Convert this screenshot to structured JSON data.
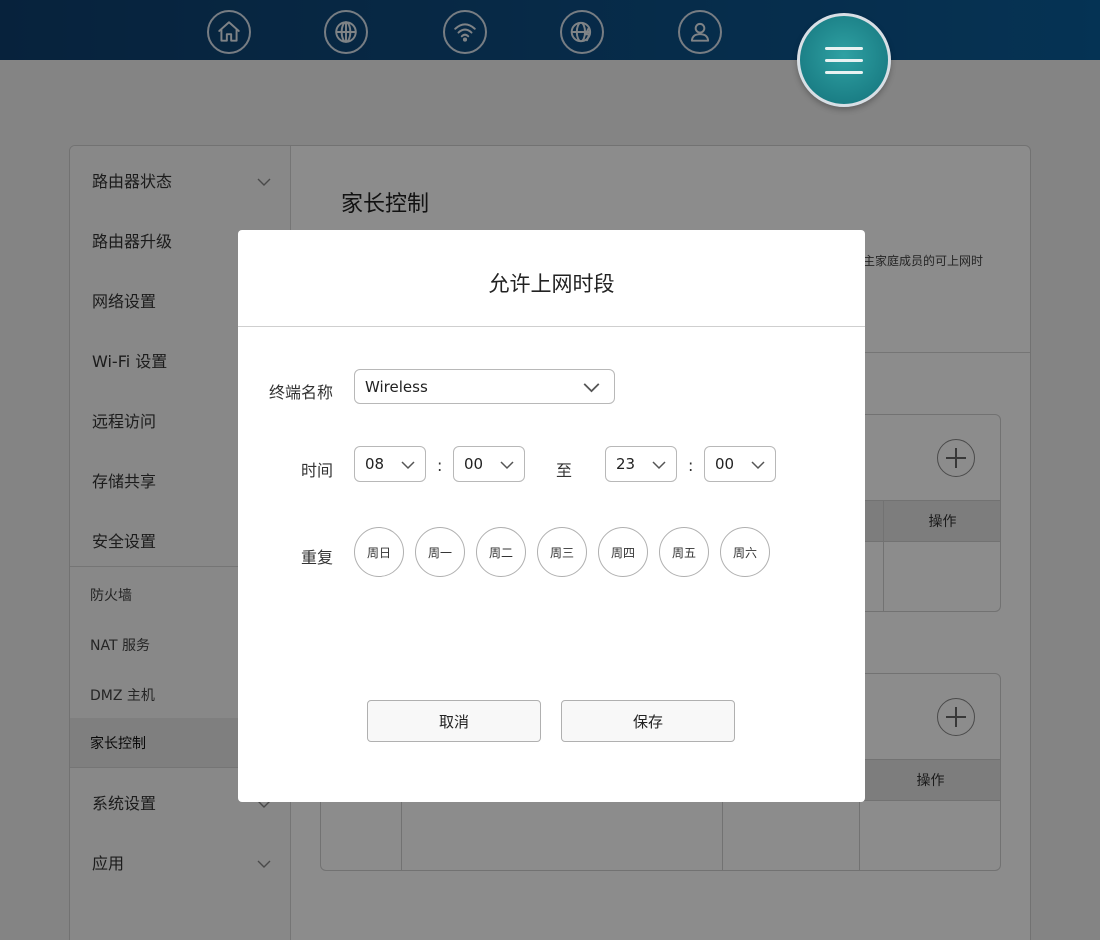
{
  "nav": {
    "icons": [
      "home-icon",
      "globe-icon",
      "wifi-icon",
      "globe-lightning-icon",
      "user-icon",
      "menu-icon"
    ]
  },
  "sidebar": {
    "items": [
      {
        "label": "路由器状态",
        "expandable": true
      },
      {
        "label": "路由器升级"
      },
      {
        "label": "网络设置"
      },
      {
        "label": "Wi-Fi 设置"
      },
      {
        "label": "远程访问"
      },
      {
        "label": "存储共享"
      },
      {
        "label": "安全设置"
      }
    ],
    "sub_items": [
      {
        "label": "防火墙"
      },
      {
        "label": "NAT 服务"
      },
      {
        "label": "DMZ 主机"
      },
      {
        "label": "家长控制",
        "active": true
      }
    ],
    "items_after": [
      {
        "label": "系统设置",
        "expandable": true
      },
      {
        "label": "应用",
        "expandable": true
      }
    ]
  },
  "content": {
    "title": "家长控制",
    "description_fragment": "主家庭成员的可上网时",
    "table1": {
      "op_header": "操作"
    },
    "table2": {
      "op_header": "操作"
    }
  },
  "dialog": {
    "title": "允许上网时段",
    "terminal_label": "终端名称",
    "terminal_value": "Wireless",
    "time_label": "时间",
    "start_hour": "08",
    "start_minute": "00",
    "to_label": "至",
    "end_hour": "23",
    "end_minute": "00",
    "colon": ":",
    "repeat_label": "重复",
    "days": [
      "周日",
      "周一",
      "周二",
      "周三",
      "周四",
      "周五",
      "周六"
    ],
    "cancel_label": "取消",
    "save_label": "保存"
  },
  "colors": {
    "topbar": "#0d4d82",
    "fab": "#1b7f86",
    "overlay": "rgba(0,0,0,0.45)"
  }
}
